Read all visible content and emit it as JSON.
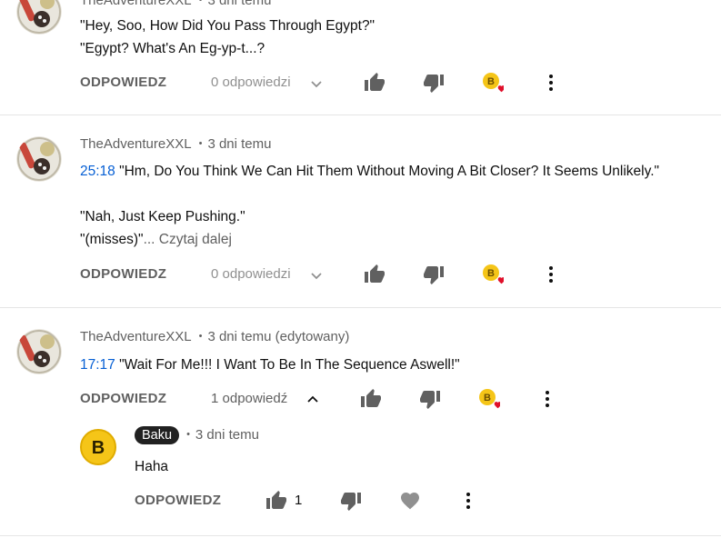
{
  "comments": [
    {
      "author": "TheAdventureXXL",
      "time": "3 dni temu",
      "lines": [
        "\"Hey, Soo, How Did You Pass Through Egypt?\"",
        "\"Egypt? What's An Eg-yp-t...?"
      ],
      "reply_label": "ODPOWIEDZ",
      "replies_count": "0 odpowiedzi"
    },
    {
      "author": "TheAdventureXXL",
      "time": "3 dni temu",
      "timestamp": "25:18",
      "line1_rest": " \"Hm, Do You Think We Can Hit Them Without Moving A Bit Closer? It Seems Unlikely.\"",
      "line2": "\"Nah, Just Keep Pushing.\"",
      "line3": "\"(misses)\"",
      "read_more": "... Czytaj dalej",
      "reply_label": "ODPOWIEDZ",
      "replies_count": "0 odpowiedzi"
    },
    {
      "author": "TheAdventureXXL",
      "time": "3 dni temu (edytowany)",
      "timestamp": "17:17",
      "line1_rest": " \"Wait For Me!!! I Want To Be In The Sequence Aswell!\"",
      "reply_label": "ODPOWIEDZ",
      "replies_count": "1 odpowiedź"
    }
  ],
  "reply": {
    "author": "Baku",
    "time": "3 dni temu",
    "avatar_letter": "B",
    "text": "Haha",
    "reply_label": "ODPOWIEDZ",
    "likes": "1"
  },
  "icons": {
    "like": "thumbs-up-icon",
    "dislike": "thumbs-down-icon",
    "heart": "creator-heart-icon",
    "menu": "more-vertical-icon",
    "chevron_down": "chevron-down-icon",
    "chevron_up": "chevron-up-icon"
  },
  "colors": {
    "link": "#065fd4",
    "muted": "#606060",
    "heart": "#e0102b",
    "coin": "#f5c518"
  }
}
